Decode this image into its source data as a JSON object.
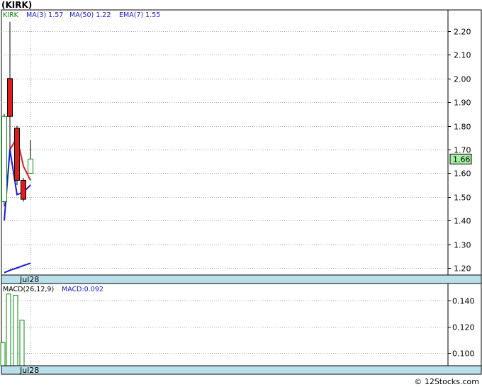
{
  "ticker_title": "(KIRK)",
  "footer": "© 12Stocks.com",
  "price_panel": {
    "legend": [
      {
        "text": "KIRK",
        "color": "#0a8a0a"
      },
      {
        "text": "MA(3)  1.57",
        "color": "#1a1ad6"
      },
      {
        "text": "MA(50)  1.22",
        "color": "#1a1ad6"
      },
      {
        "text": "EMA(7)  1.55",
        "color": "#1a1ad6"
      }
    ],
    "last_price_label": "1.66",
    "date_label": "Jul28"
  },
  "macd_panel": {
    "legend": [
      {
        "text": "MACD(26,12,9)",
        "color": "#000000"
      },
      {
        "text": "MACD:0.092",
        "color": "#1a1ad6"
      }
    ],
    "date_label": "Jul28"
  },
  "colors": {
    "up_fill": "#ffffff",
    "up_stroke": "#0a8a0a",
    "down_fill": "#e31b1b",
    "wick": "#000000",
    "ma3": "#e31b1b",
    "ma_blue": "#1a1ad6",
    "axis_band": "#b9dfea",
    "price_tag": "#a6f0a6",
    "grid": "#a8a8a8"
  },
  "chart_data": [
    {
      "type": "candlestick",
      "title": "(KIRK)",
      "ylim": [
        1.15,
        2.25
      ],
      "y_ticks": [
        1.2,
        1.3,
        1.4,
        1.5,
        1.6,
        1.7,
        1.8,
        1.9,
        2.0,
        2.1,
        2.2
      ],
      "x_labels": [
        "Jul28"
      ],
      "candles": [
        {
          "open": 1.48,
          "high": 1.85,
          "low": 1.46,
          "close": 1.84
        },
        {
          "open": 2.0,
          "high": 2.24,
          "low": 1.7,
          "close": 1.84
        },
        {
          "open": 1.79,
          "high": 1.8,
          "low": 1.55,
          "close": 1.57
        },
        {
          "open": 1.57,
          "high": 1.58,
          "low": 1.48,
          "close": 1.49
        },
        {
          "open": 1.6,
          "high": 1.74,
          "low": 1.6,
          "close": 1.66
        }
      ],
      "series": [
        {
          "name": "MA(3)",
          "values": [
            null,
            1.7,
            1.75,
            1.63,
            1.57
          ]
        },
        {
          "name": "EMA(7)",
          "values": [
            1.4,
            1.7,
            1.51,
            1.52,
            1.55
          ]
        },
        {
          "name": "MA(50)",
          "values": [
            1.18,
            1.19,
            1.2,
            1.21,
            1.22
          ]
        }
      ]
    },
    {
      "type": "bar",
      "title": "MACD(26,12,9)",
      "ylim": [
        0.08,
        0.15
      ],
      "y_ticks": [
        0.1,
        0.12,
        0.14
      ],
      "x_labels": [
        "Jul28"
      ],
      "values": [
        0.108,
        0.145,
        0.144,
        0.125,
        0.083
      ]
    }
  ]
}
